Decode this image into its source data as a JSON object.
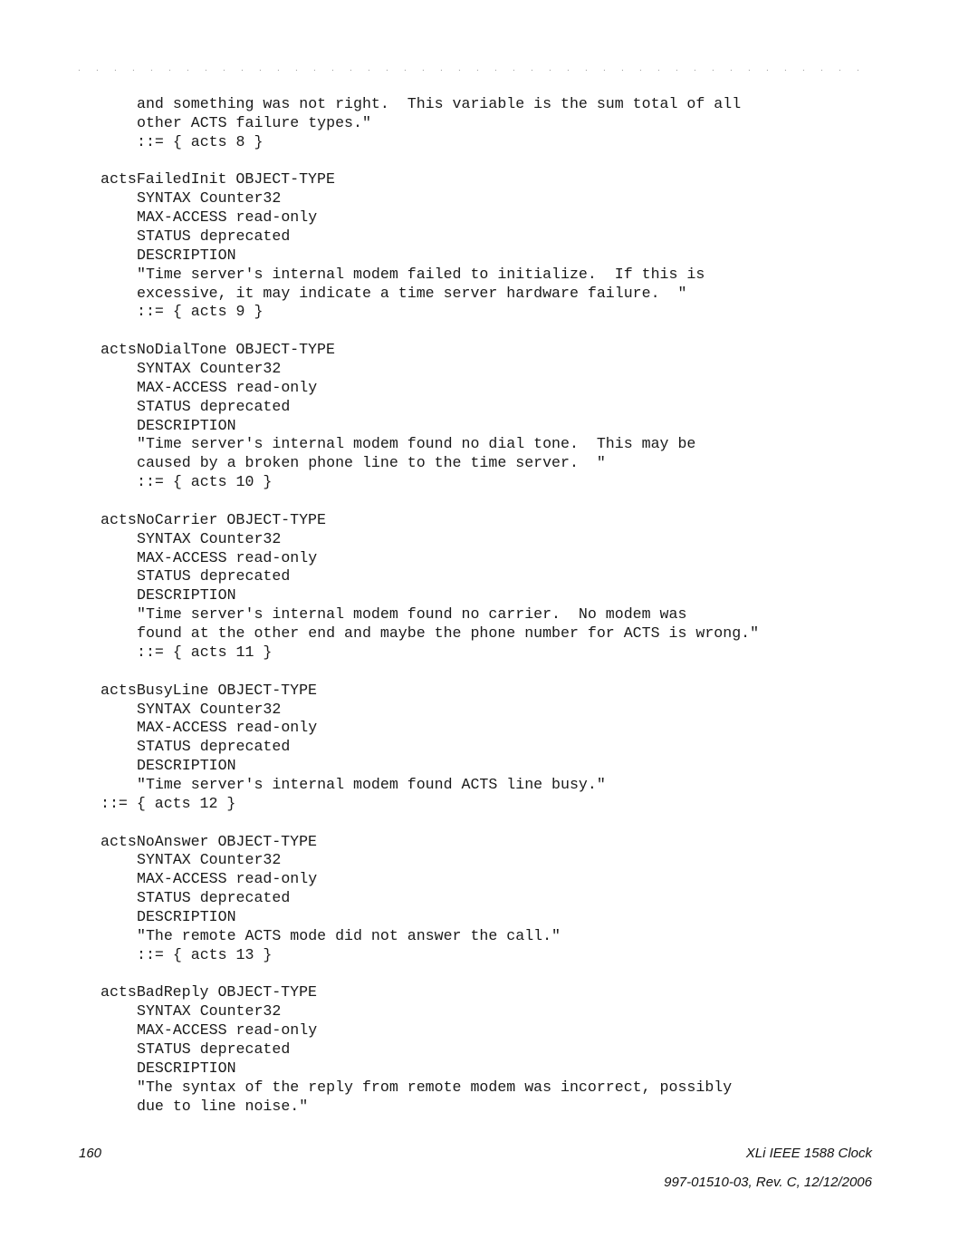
{
  "header": {
    "dots": ". . . . . . . . . . . . . . . . . . . . . . . . . . . . . . . . . . . . . . . . . . . . ."
  },
  "lines": [
    {
      "indent": 1,
      "text": "and something was not right.  This variable is the sum total of all"
    },
    {
      "indent": 1,
      "text": "other ACTS failure types.\""
    },
    {
      "indent": 1,
      "text": "::= { acts 8 }"
    },
    {
      "indent": 0,
      "text": ""
    },
    {
      "indent": 0,
      "text": "actsFailedInit OBJECT-TYPE"
    },
    {
      "indent": 1,
      "text": "SYNTAX Counter32"
    },
    {
      "indent": 1,
      "text": "MAX-ACCESS read-only"
    },
    {
      "indent": 1,
      "text": "STATUS deprecated"
    },
    {
      "indent": 1,
      "text": "DESCRIPTION"
    },
    {
      "indent": 1,
      "text": "\"Time server's internal modem failed to initialize.  If this is"
    },
    {
      "indent": 1,
      "text": "excessive, it may indicate a time server hardware failure.  \""
    },
    {
      "indent": 1,
      "text": "::= { acts 9 }"
    },
    {
      "indent": 0,
      "text": ""
    },
    {
      "indent": 0,
      "text": "actsNoDialTone OBJECT-TYPE"
    },
    {
      "indent": 1,
      "text": "SYNTAX Counter32"
    },
    {
      "indent": 1,
      "text": "MAX-ACCESS read-only"
    },
    {
      "indent": 1,
      "text": "STATUS deprecated"
    },
    {
      "indent": 1,
      "text": "DESCRIPTION"
    },
    {
      "indent": 1,
      "text": "\"Time server's internal modem found no dial tone.  This may be"
    },
    {
      "indent": 1,
      "text": "caused by a broken phone line to the time server.  \""
    },
    {
      "indent": 1,
      "text": "::= { acts 10 }"
    },
    {
      "indent": 0,
      "text": ""
    },
    {
      "indent": 0,
      "text": "actsNoCarrier OBJECT-TYPE"
    },
    {
      "indent": 1,
      "text": "SYNTAX Counter32"
    },
    {
      "indent": 1,
      "text": "MAX-ACCESS read-only"
    },
    {
      "indent": 1,
      "text": "STATUS deprecated"
    },
    {
      "indent": 1,
      "text": "DESCRIPTION"
    },
    {
      "indent": 1,
      "text": "\"Time server's internal modem found no carrier.  No modem was"
    },
    {
      "indent": 1,
      "text": "found at the other end and maybe the phone number for ACTS is wrong.\""
    },
    {
      "indent": 1,
      "text": "::= { acts 11 }"
    },
    {
      "indent": 0,
      "text": ""
    },
    {
      "indent": 0,
      "text": "actsBusyLine OBJECT-TYPE"
    },
    {
      "indent": 1,
      "text": "SYNTAX Counter32"
    },
    {
      "indent": 1,
      "text": "MAX-ACCESS read-only"
    },
    {
      "indent": 1,
      "text": "STATUS deprecated"
    },
    {
      "indent": 1,
      "text": "DESCRIPTION"
    },
    {
      "indent": 1,
      "text": "\"Time server's internal modem found ACTS line busy.\""
    },
    {
      "indent": 0,
      "text": "::= { acts 12 }"
    },
    {
      "indent": 0,
      "text": ""
    },
    {
      "indent": 0,
      "text": "actsNoAnswer OBJECT-TYPE"
    },
    {
      "indent": 1,
      "text": "SYNTAX Counter32"
    },
    {
      "indent": 1,
      "text": "MAX-ACCESS read-only"
    },
    {
      "indent": 1,
      "text": "STATUS deprecated"
    },
    {
      "indent": 1,
      "text": "DESCRIPTION"
    },
    {
      "indent": 1,
      "text": "\"The remote ACTS mode did not answer the call.\""
    },
    {
      "indent": 1,
      "text": "::= { acts 13 }"
    },
    {
      "indent": 0,
      "text": ""
    },
    {
      "indent": 0,
      "text": "actsBadReply OBJECT-TYPE"
    },
    {
      "indent": 1,
      "text": "SYNTAX Counter32"
    },
    {
      "indent": 1,
      "text": "MAX-ACCESS read-only"
    },
    {
      "indent": 1,
      "text": "STATUS deprecated"
    },
    {
      "indent": 1,
      "text": "DESCRIPTION"
    },
    {
      "indent": 1,
      "text": "\"The syntax of the reply from remote modem was incorrect, possibly"
    },
    {
      "indent": 1,
      "text": "due to line noise.\""
    }
  ],
  "footer": {
    "page_number": "160",
    "doc_title": "XLi IEEE 1588 Clock",
    "doc_revision": "997-01510-03, Rev. C, 12/12/2006"
  }
}
